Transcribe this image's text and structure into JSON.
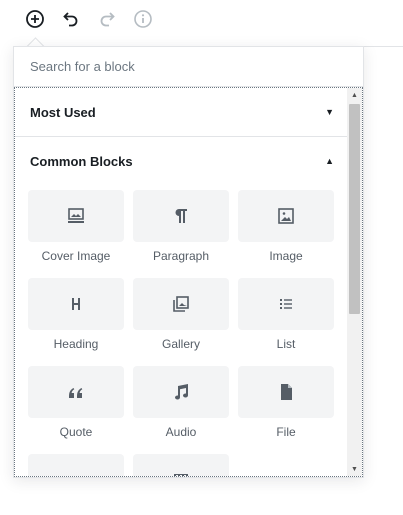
{
  "toolbar": {
    "add_icon": "plus-circle-icon",
    "undo_icon": "undo-icon",
    "redo_icon": "redo-icon",
    "info_icon": "info-icon"
  },
  "inserter": {
    "search_placeholder": "Search for a block",
    "panels": {
      "most_used": {
        "label": "Most Used",
        "caret": "▼"
      },
      "common_blocks": {
        "label": "Common Blocks",
        "caret": "▲"
      }
    },
    "blocks": [
      {
        "label": "Cover Image",
        "icon": "cover-image-icon"
      },
      {
        "label": "Paragraph",
        "icon": "paragraph-icon"
      },
      {
        "label": "Image",
        "icon": "image-icon"
      },
      {
        "label": "Heading",
        "icon": "heading-icon"
      },
      {
        "label": "Gallery",
        "icon": "gallery-icon"
      },
      {
        "label": "List",
        "icon": "list-icon"
      },
      {
        "label": "Quote",
        "icon": "quote-icon"
      },
      {
        "label": "Audio",
        "icon": "audio-icon"
      },
      {
        "label": "File",
        "icon": "file-icon"
      },
      {
        "label": "",
        "icon": "subhead-icon"
      },
      {
        "label": "",
        "icon": "video-icon"
      }
    ]
  },
  "colors": {
    "tile_bg": "#f3f4f5",
    "icon": "#555d66",
    "border": "#e2e4e7",
    "text": "#191e23"
  }
}
